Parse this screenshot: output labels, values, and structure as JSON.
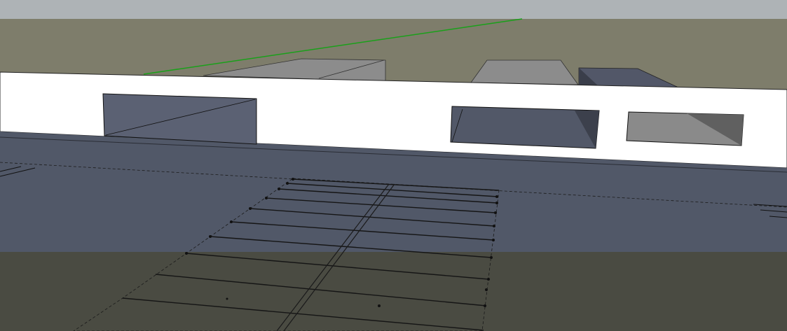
{
  "app": {
    "viewport_label": "",
    "colors": {
      "sky_top": "#aab0b3",
      "sky": "#7c7c6b",
      "ground": "#4a4b42",
      "roof_dark": "#515868",
      "roof_light": "#ffffff",
      "box_grey": "#8a8a8a",
      "box_dark": "#505566",
      "axis_green": "#1aa01a"
    },
    "icons": [
      "green-axis-line"
    ]
  }
}
